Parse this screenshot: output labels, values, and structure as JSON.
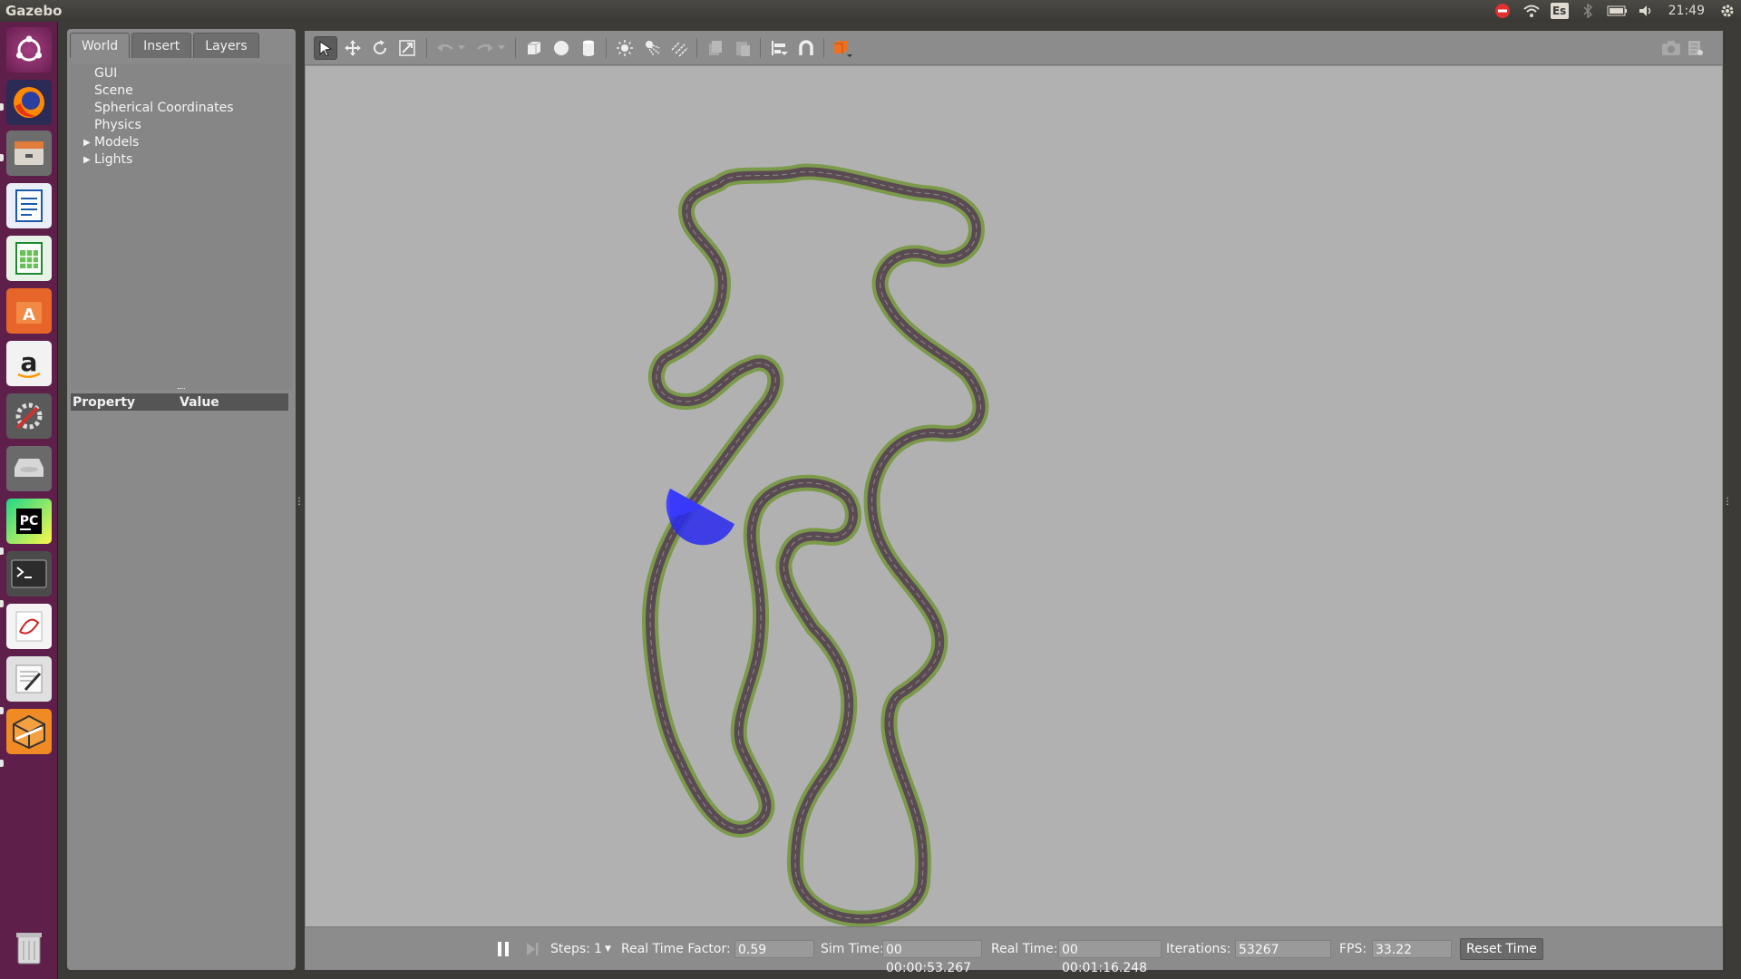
{
  "topbar": {
    "title": "Gazebo",
    "keyboard_layout": "Es",
    "clock": "21:49",
    "icons": [
      "stop-icon",
      "wifi-icon",
      "keyboard-icon",
      "bluetooth-icon",
      "battery-icon",
      "volume-icon",
      "clock",
      "gear-icon"
    ]
  },
  "launcher": {
    "items": [
      "ubuntu-dash",
      "firefox",
      "files",
      "libreoffice-writer",
      "libreoffice-calc",
      "software-center",
      "amazon",
      "system-settings",
      "disks",
      "pycharm",
      "terminal",
      "evince",
      "text-editor",
      "gazebo"
    ],
    "trash": "trash"
  },
  "left_panel": {
    "tabs": [
      "World",
      "Insert",
      "Layers"
    ],
    "active_tab": "World",
    "tree": [
      {
        "label": "GUI",
        "expandable": false
      },
      {
        "label": "Scene",
        "expandable": false
      },
      {
        "label": "Spherical Coordinates",
        "expandable": false
      },
      {
        "label": "Physics",
        "expandable": false
      },
      {
        "label": "Models",
        "expandable": true
      },
      {
        "label": "Lights",
        "expandable": true
      }
    ],
    "properties": {
      "col_property": "Property",
      "col_value": "Value"
    }
  },
  "toolbar": {
    "tools": [
      "select-mode",
      "translate-mode",
      "rotate-mode",
      "scale-mode",
      "undo",
      "undo-history",
      "redo",
      "redo-history",
      "box-shape",
      "sphere-shape",
      "cylinder-shape",
      "point-light",
      "spot-light",
      "directional-light",
      "copy",
      "paste",
      "align",
      "snap",
      "change-view"
    ],
    "right_tools": [
      "screenshot",
      "log"
    ]
  },
  "bottom": {
    "steps_label": "Steps:",
    "steps_value": "1",
    "rtf_label": "Real Time Factor:",
    "rtf_value": "0.59",
    "sim_time_label": "Sim Time:",
    "sim_time_value": "00 00:00:53.267",
    "real_time_label": "Real Time:",
    "real_time_value": "00 00:01:16.248",
    "iterations_label": "Iterations:",
    "iterations_value": "53267",
    "fps_label": "FPS:",
    "fps_value": "33.22",
    "reset_label": "Reset Time"
  },
  "colors": {
    "launcher_bg": "#5e1f4a",
    "viewport_bg": "#b1b1b1",
    "track_edge": "#7b9a4a",
    "track_surface": "#5a4a52",
    "sensor": "#2a2af0"
  }
}
